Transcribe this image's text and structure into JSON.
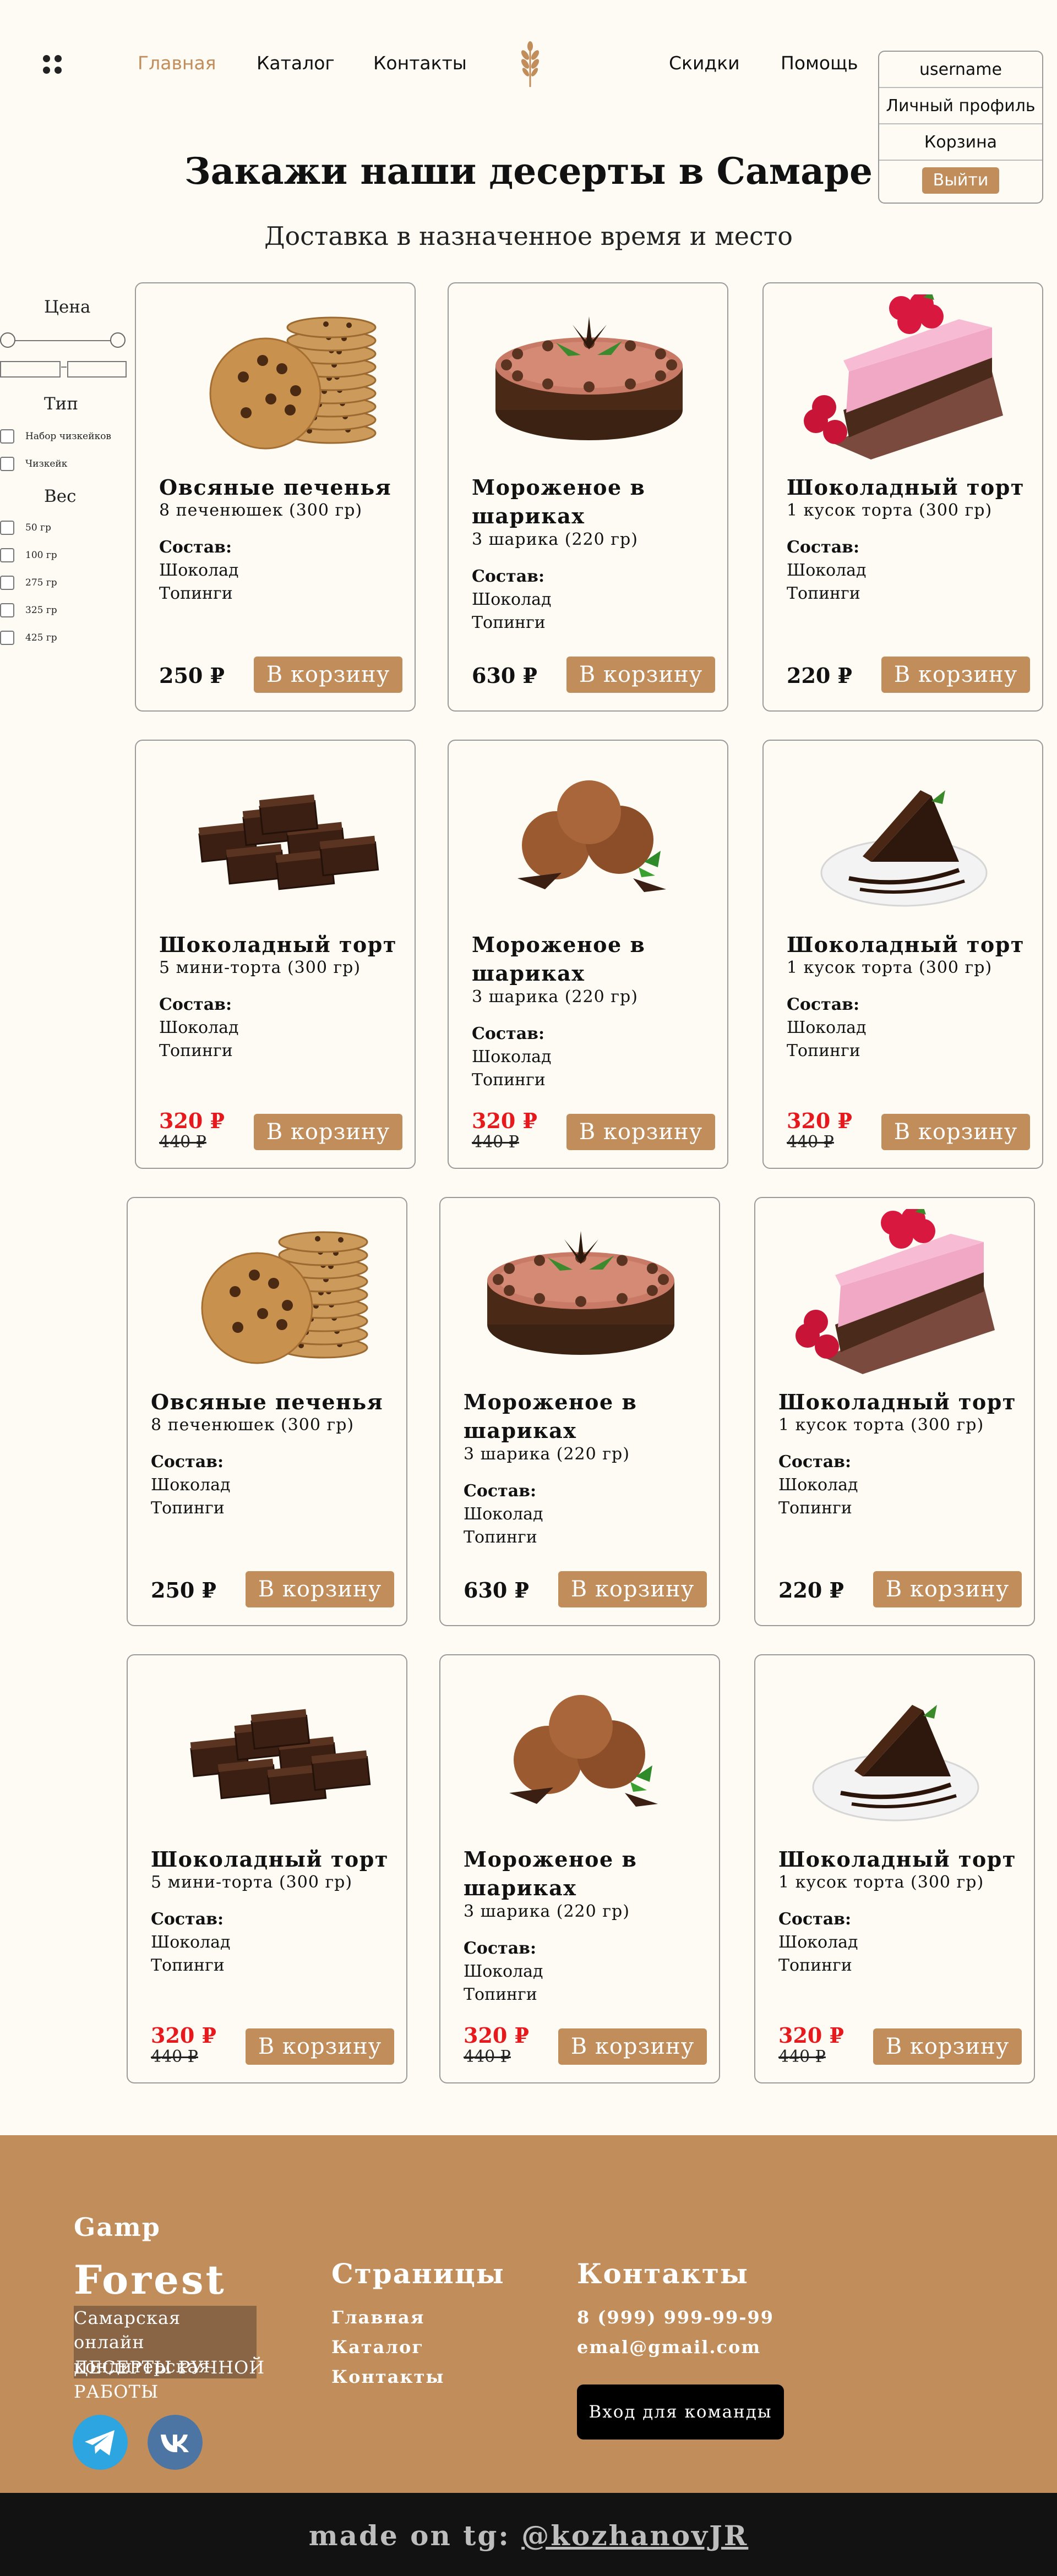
{
  "header": {
    "nav": [
      {
        "label": "Главная",
        "active": true
      },
      {
        "label": "Каталог",
        "active": false
      },
      {
        "label": "Контакты",
        "active": false
      },
      {
        "label": "Скидки",
        "active": false
      },
      {
        "label": "Помощь",
        "active": false
      }
    ],
    "logo_icon": "wheat-icon",
    "menu_icon": "grid-dots-icon",
    "accent_color": "#c08d5b"
  },
  "user_menu": {
    "username": "username",
    "profile": "Личный профиль",
    "cart": "Корзина",
    "logout": "Выйти"
  },
  "hero": {
    "title": "Закажи наши десерты в Самаре",
    "subtitle": "Доставка в назначенное время и место"
  },
  "filters": {
    "price_heading": "Цена",
    "type_heading": "Тип",
    "types": [
      "Набор чизкейков",
      "Чизкейк"
    ],
    "weight_heading": "Вес",
    "weights": [
      "50 гр",
      "100 гр",
      "275 гр",
      "325 гр",
      "425 гр"
    ]
  },
  "ingredients_heading": "Состав:",
  "cart_button": "В корзину",
  "products": [
    {
      "name": "Овсяные печенья",
      "desc": "8 печенюшек (300 гр)",
      "ingredients": [
        "Шоколад",
        "Топинги"
      ],
      "price": "250 ₽",
      "old_price": "",
      "image": "cookies"
    },
    {
      "name": "Мороженое в шариках",
      "desc": "3 шарика (220 гр)",
      "ingredients": [
        "Шоколад",
        "Топинги"
      ],
      "price": "630 ₽",
      "old_price": "",
      "image": "round-cake"
    },
    {
      "name": "Шоколадный торт",
      "desc": "1 кусок торта (300 гр)",
      "ingredients": [
        "Шоколад",
        "Топинги"
      ],
      "price": "220 ₽",
      "old_price": "",
      "image": "berry-slice"
    },
    {
      "name": "Шоколадный торт",
      "desc": "5 мини-торта (300 гр)",
      "ingredients": [
        "Шоколад",
        "Топинги"
      ],
      "price": "320 ₽",
      "old_price": "440 ₽",
      "image": "brownies"
    },
    {
      "name": "Мороженое в шариках",
      "desc": "3 шарика (220 гр)",
      "ingredients": [
        "Шоколад",
        "Топинги"
      ],
      "price": "320 ₽",
      "old_price": "440 ₽",
      "image": "ice-cream"
    },
    {
      "name": "Шоколадный торт",
      "desc": "1 кусок торта (300 гр)",
      "ingredients": [
        "Шоколад",
        "Топинги"
      ],
      "price": "320 ₽",
      "old_price": "440 ₽",
      "image": "choc-slice"
    },
    {
      "name": "Овсяные печенья",
      "desc": "8 печенюшек (300 гр)",
      "ingredients": [
        "Шоколад",
        "Топинги"
      ],
      "price": "250 ₽",
      "old_price": "",
      "image": "cookies"
    },
    {
      "name": "Мороженое в шариках",
      "desc": "3 шарика (220 гр)",
      "ingredients": [
        "Шоколад",
        "Топинги"
      ],
      "price": "630 ₽",
      "old_price": "",
      "image": "round-cake"
    },
    {
      "name": "Шоколадный торт",
      "desc": "1 кусок торта (300 гр)",
      "ingredients": [
        "Шоколад",
        "Топинги"
      ],
      "price": "220 ₽",
      "old_price": "",
      "image": "berry-slice"
    },
    {
      "name": "Шоколадный торт",
      "desc": "5 мини-торта (300 гр)",
      "ingredients": [
        "Шоколад",
        "Топинги"
      ],
      "price": "320 ₽",
      "old_price": "440 ₽",
      "image": "brownies"
    },
    {
      "name": "Мороженое в шариках",
      "desc": "3 шарика (220 гр)",
      "ingredients": [
        "Шоколад",
        "Топинги"
      ],
      "price": "320 ₽",
      "old_price": "440 ₽",
      "image": "ice-cream"
    },
    {
      "name": "Шоколадный торт",
      "desc": "1 кусок торта (300 гр)",
      "ingredients": [
        "Шоколад",
        "Топинги"
      ],
      "price": "320 ₽",
      "old_price": "440 ₽",
      "image": "choc-slice"
    }
  ],
  "footer": {
    "brand_small": "Gamp",
    "brand_big": "Forest",
    "desc_highlight": "Самарская онлайн кондитерская",
    "desc": "ДЕСЕРТЫ РУЧНОЙ РАБОТЫ",
    "pages_heading": "Страницы",
    "pages": [
      "Главная",
      "Каталог",
      "Контакты"
    ],
    "contacts_heading": "Контакты",
    "phone": "8 (999) 999-99-99",
    "email": "emal@gmail.com",
    "team_button": "Вход для команды",
    "social": [
      "telegram-icon",
      "vk-icon"
    ]
  },
  "bottom": {
    "made_prefix": "made on tg: ",
    "handle": "@kozhanovJR"
  }
}
